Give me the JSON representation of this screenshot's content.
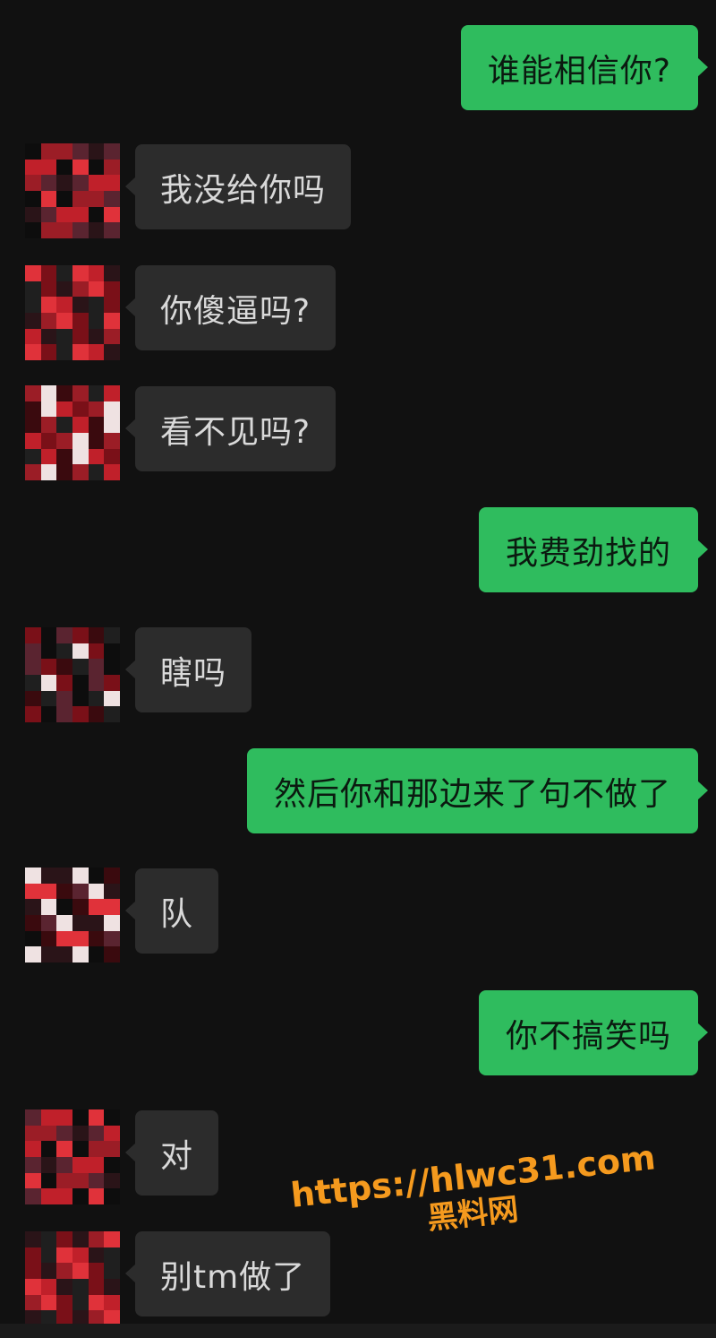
{
  "messages": [
    {
      "side": "out",
      "text": "谁能相信你?"
    },
    {
      "side": "in",
      "text": "我没给你吗"
    },
    {
      "side": "in",
      "text": "你傻逼吗?"
    },
    {
      "side": "in",
      "text": "看不见吗?"
    },
    {
      "side": "out",
      "text": "我费劲找的"
    },
    {
      "side": "in",
      "text": "瞎吗"
    },
    {
      "side": "out",
      "text": "然后你和那边来了句不做了"
    },
    {
      "side": "in",
      "text": "队"
    },
    {
      "side": "out",
      "text": "你不搞笑吗"
    },
    {
      "side": "in",
      "text": "对"
    },
    {
      "side": "in",
      "text": "别tm做了"
    }
  ],
  "watermark": {
    "url": "https://hlwc31.com",
    "site": "黑料网"
  },
  "colors": {
    "background": "#111111",
    "incoming_bubble": "#2c2c2c",
    "outgoing_bubble": "#2fbc5e",
    "watermark": "#f59a1e"
  },
  "icons": {
    "avatar": "pixelated-avatar-icon"
  }
}
